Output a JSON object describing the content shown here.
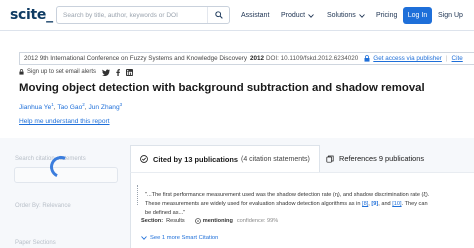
{
  "header": {
    "logo": "scite_",
    "search_placeholder": "Search by title, author, keywords or DOI",
    "nav": [
      {
        "label": "Assistant"
      },
      {
        "label": "Product"
      },
      {
        "label": "Solutions"
      },
      {
        "label": "Pricing"
      }
    ],
    "login": "Log In",
    "signup": "Sign Up"
  },
  "paper": {
    "venue": "2012 9th International Conference on Fuzzy Systems and Knowledge Discovery",
    "year": "2012",
    "doi": "DOI: 10.1109/fskd.2012.6234020",
    "access_link": "Get access via publisher",
    "cite_link": "Cite",
    "alerts": "Sign up to set email alerts",
    "title": "Moving object detection with background subtraction and shadow removal",
    "authors": [
      {
        "name": "Jianhua Ye",
        "sup": "1"
      },
      {
        "name": "Tao Gao",
        "sup": "2"
      },
      {
        "name": "Jun Zhang",
        "sup": "3"
      }
    ],
    "help_link": "Help me understand this report"
  },
  "filters": {
    "search": "Search citation statements",
    "order": "Order By: Relevance",
    "sections": "Paper Sections"
  },
  "tabs": {
    "cited": {
      "label": "Cited by 13 publications",
      "count": "(4 citation statements)"
    },
    "references": {
      "label": "References 9 publications"
    }
  },
  "citation": {
    "q1": "\"...The first performance measurement used was the shadow detection rate (η), and shadow discrimination rate (ξ).",
    "q2": "These measurements are widely used for evaluation shadow detection algorithms as in ",
    "r1": "[8]",
    "r2": "[9]",
    "and": ", and ",
    "r3": "[10]",
    "q3": ". They can",
    "q4": "be defined as...\"",
    "section_label": "Section:",
    "section_value": "Results",
    "mentioning": "mentioning",
    "confidence": "confidence: 99%",
    "see_more": "See 1 more Smart Citation"
  },
  "colors": {
    "accent": "#1e6fd9",
    "brand": "#0f3b63",
    "background_lower": "#f6f8fb"
  }
}
